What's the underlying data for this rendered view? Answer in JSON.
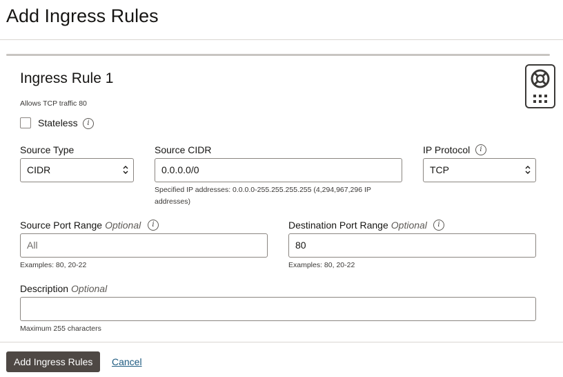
{
  "page": {
    "title": "Add Ingress Rules"
  },
  "rule": {
    "title": "Ingress Rule 1",
    "description": "Allows TCP traffic 80",
    "stateless_label": "Stateless"
  },
  "source_type": {
    "label": "Source Type",
    "value": "CIDR"
  },
  "source_cidr": {
    "label": "Source CIDR",
    "value": "0.0.0.0/0",
    "hint_line1": "Specified IP addresses: 0.0.0.0-255.255.255.255 (4,294,967,296 IP",
    "hint_line2": "addresses)"
  },
  "ip_protocol": {
    "label": "IP Protocol",
    "value": "TCP"
  },
  "source_port_range": {
    "label": "Source Port Range",
    "optional": "Optional",
    "placeholder": "All",
    "hint": "Examples: 80, 20-22"
  },
  "destination_port_range": {
    "label": "Destination Port Range",
    "optional": "Optional",
    "value": "80",
    "hint": "Examples: 80, 20-22"
  },
  "description_field": {
    "label": "Description",
    "optional": "Optional",
    "value": "",
    "hint": "Maximum 255 characters"
  },
  "info_icon_glyph": "i",
  "footer": {
    "primary_label": "Add Ingress Rules",
    "cancel_label": "Cancel"
  },
  "icons": {
    "help": "lifebuoy-icon",
    "apps": "grid-icon",
    "info": "info-icon",
    "select": "chevron-up-down-icon"
  }
}
